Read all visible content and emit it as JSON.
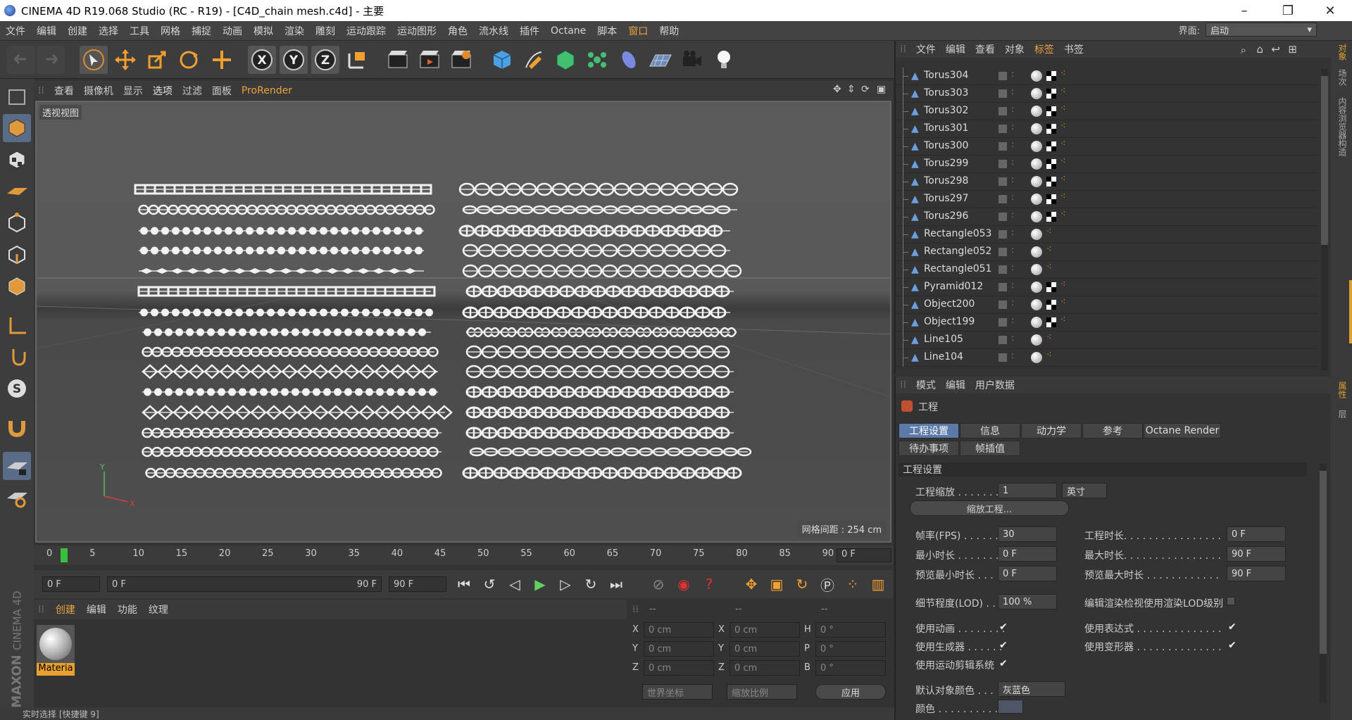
{
  "window": {
    "title": "CINEMA 4D R19.068 Studio (RC - R19) - [C4D_chain mesh.c4d] - 主要"
  },
  "menu": [
    "文件",
    "编辑",
    "创建",
    "选择",
    "工具",
    "网格",
    "捕捉",
    "动画",
    "模拟",
    "渲染",
    "雕刻",
    "运动跟踪",
    "运动图形",
    "角色",
    "流水线",
    "插件",
    "Octane",
    "脚本",
    "窗口",
    "帮助"
  ],
  "layout": {
    "label": "界面:",
    "value": "启动"
  },
  "viewport": {
    "menu": [
      "查看",
      "摄像机",
      "显示",
      "选项",
      "过滤",
      "面板",
      "ProRender"
    ],
    "label": "透视视图",
    "grid": "网格间距 : 254 cm"
  },
  "timeline": {
    "ticks": [
      "0",
      "5",
      "10",
      "15",
      "20",
      "25",
      "30",
      "35",
      "40",
      "45",
      "50",
      "55",
      "60",
      "65",
      "70",
      "75",
      "80",
      "85",
      "90"
    ],
    "current": "0 F"
  },
  "playback": {
    "start": "0 F",
    "range_start": "0 F",
    "range_end": "90 F",
    "end": "90 F"
  },
  "materials": {
    "tabs": [
      "创建",
      "编辑",
      "功能",
      "纹理"
    ],
    "items": [
      {
        "name": "Materia"
      }
    ]
  },
  "coords": {
    "headers": [
      "--",
      "--",
      "--"
    ],
    "rows": [
      {
        "a": "X",
        "av": "0 cm",
        "b": "X",
        "bv": "0 cm",
        "c": "H",
        "cv": "0 °"
      },
      {
        "a": "Y",
        "av": "0 cm",
        "b": "Y",
        "bv": "0 cm",
        "c": "P",
        "cv": "0 °"
      },
      {
        "a": "Z",
        "av": "0 cm",
        "b": "Z",
        "bv": "0 cm",
        "c": "B",
        "cv": "0 °"
      }
    ],
    "mode1": "世界坐标",
    "mode2": "缩放比例",
    "apply": "应用"
  },
  "status": "实时选择 [快捷键 9]",
  "object_manager": {
    "menu": [
      "文件",
      "编辑",
      "查看",
      "对象",
      "标签",
      "书签"
    ],
    "objects": [
      "Torus304",
      "Torus303",
      "Torus302",
      "Torus301",
      "Torus300",
      "Torus299",
      "Torus298",
      "Torus297",
      "Torus296",
      "Rectangle053",
      "Rectangle052",
      "Rectangle051",
      "Pyramid012",
      "Object200",
      "Object199",
      "Line105",
      "Line104"
    ]
  },
  "attributes": {
    "menu": [
      "模式",
      "编辑",
      "用户数据"
    ],
    "section": "工程",
    "tabs": [
      "工程设置",
      "信息",
      "动力学",
      "参考",
      "Octane Render",
      "待办事项",
      "帧插值"
    ],
    "group": "工程设置",
    "scale_label": "工程缩放 . . . . . . . .",
    "scale_value": "1",
    "scale_unit": "英寸",
    "scale_button": "缩放工程...",
    "fps_label": "帧率(FPS) . . . . . . .",
    "fps": "30",
    "length_label": "工程时长. . . . . . . . . . . . . . . .",
    "length": "0 F",
    "min_label": "最小时长 . . . . . . . .",
    "min": "0 F",
    "max_label": "最大时长. . . . . . . . . . . . . . . .",
    "max": "90 F",
    "pmin_label": "预览最小时长 . . .",
    "pmin": "0 F",
    "pmax_label": "预览最大时长 . . . . . . . . . . . .",
    "pmax": "90 F",
    "lod_label": "细节程度(LOD) . .",
    "lod": "100 %",
    "lod_render_label": "编辑渲染检视使用渲染LOD级别",
    "use_anim": "使用动画 . . . . . . . .",
    "use_expr": "使用表达式 . . . . . . . . . . . . . .",
    "use_gen": "使用生成器 . . . . . .",
    "use_deform": "使用变形器 . . . . . . . . . . . . . .",
    "use_mo": "使用运动剪辑系统",
    "color_label": "默认对象颜色 . . .",
    "color_value": "灰蓝色",
    "color2_label": "颜色 . . . . . . . . . . . ."
  }
}
